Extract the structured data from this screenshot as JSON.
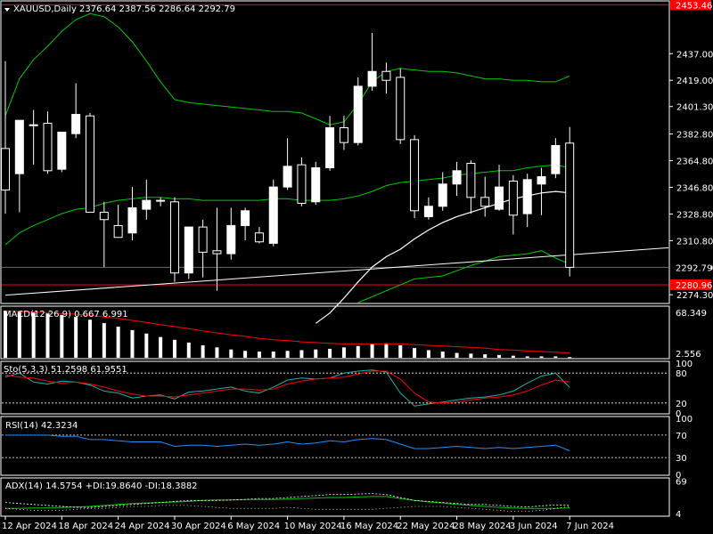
{
  "header": {
    "symbol": "XAUUSD,Daily",
    "ohlc": "2376.64 2387.56 2286.64 2292.79"
  },
  "colors": {
    "background": "#000000",
    "foreground": "#ffffff",
    "bull": "#ffffff",
    "bear": "#000000",
    "candle_outline": "#ffffff",
    "indicator_green": "#00c800",
    "moving_average": "#ffffff",
    "hline": "#ff0000",
    "macd_signal": "#ff0000",
    "stoch_main": "#20b2aa",
    "stoch_signal": "#ff0000",
    "rsi": "#1e90ff",
    "adx_dash": "#ffffff",
    "current_price_line": "#6b6b6b"
  },
  "chart_data": {
    "type": "candlestick",
    "symbol": "XAUUSD",
    "timeframe": "Daily",
    "price_axis_ticks": [
      "2437.00",
      "2419.00",
      "2401.30",
      "2382.80",
      "2364.80",
      "2346.80",
      "2328.80",
      "2310.80",
      "2292.79",
      "2274.30"
    ],
    "price_ylim": [
      2269,
      2472
    ],
    "horizontal_lines": [
      {
        "price": 2470.0,
        "label": "2453.46"
      },
      {
        "price": 2281.0,
        "label": "2280.96"
      }
    ],
    "current_price": 2292.79,
    "date_labels": [
      "12 Apr 2024",
      "18 Apr 2024",
      "24 Apr 2024",
      "30 Apr 2024",
      "6 May 2024",
      "10 May 2024",
      "16 May 2024",
      "22 May 2024",
      "28 May 2024",
      "3 Jun 2024",
      "7 Jun 2024"
    ],
    "candles": [
      {
        "o": 2373,
        "h": 2432,
        "l": 2329,
        "c": 2345
      },
      {
        "o": 2356,
        "h": 2391,
        "l": 2330,
        "c": 2392
      },
      {
        "o": 2389,
        "h": 2399,
        "l": 2362,
        "c": 2389
      },
      {
        "o": 2390,
        "h": 2398,
        "l": 2356,
        "c": 2358
      },
      {
        "o": 2359,
        "h": 2384,
        "l": 2357,
        "c": 2384
      },
      {
        "o": 2383,
        "h": 2417,
        "l": 2380,
        "c": 2396
      },
      {
        "o": 2395,
        "h": 2397,
        "l": 2330,
        "c": 2330
      },
      {
        "o": 2330,
        "h": 2337,
        "l": 2293,
        "c": 2325
      },
      {
        "o": 2321,
        "h": 2335,
        "l": 2316,
        "c": 2313
      },
      {
        "o": 2316,
        "h": 2347,
        "l": 2311,
        "c": 2333
      },
      {
        "o": 2332,
        "h": 2352,
        "l": 2325,
        "c": 2338
      },
      {
        "o": 2338,
        "h": 2340,
        "l": 2334,
        "c": 2338
      },
      {
        "o": 2337,
        "h": 2340,
        "l": 2283,
        "c": 2289
      },
      {
        "o": 2289,
        "h": 2320,
        "l": 2285,
        "c": 2320
      },
      {
        "o": 2320,
        "h": 2325,
        "l": 2286,
        "c": 2303
      },
      {
        "o": 2304,
        "h": 2333,
        "l": 2277,
        "c": 2302
      },
      {
        "o": 2302,
        "h": 2333,
        "l": 2298,
        "c": 2321
      },
      {
        "o": 2321,
        "h": 2333,
        "l": 2311,
        "c": 2331
      },
      {
        "o": 2316,
        "h": 2320,
        "l": 2309,
        "c": 2310
      },
      {
        "o": 2309,
        "h": 2352,
        "l": 2307,
        "c": 2347
      },
      {
        "o": 2347,
        "h": 2380,
        "l": 2345,
        "c": 2361
      },
      {
        "o": 2362,
        "h": 2367,
        "l": 2334,
        "c": 2336
      },
      {
        "o": 2337,
        "h": 2364,
        "l": 2335,
        "c": 2360
      },
      {
        "o": 2360,
        "h": 2395,
        "l": 2358,
        "c": 2387
      },
      {
        "o": 2387,
        "h": 2395,
        "l": 2372,
        "c": 2377
      },
      {
        "o": 2377,
        "h": 2421,
        "l": 2375,
        "c": 2415
      },
      {
        "o": 2415,
        "h": 2451,
        "l": 2412,
        "c": 2425
      },
      {
        "o": 2425,
        "h": 2431,
        "l": 2410,
        "c": 2419
      },
      {
        "o": 2421,
        "h": 2427,
        "l": 2376,
        "c": 2379
      },
      {
        "o": 2379,
        "h": 2382,
        "l": 2326,
        "c": 2331
      },
      {
        "o": 2327,
        "h": 2340,
        "l": 2325,
        "c": 2334
      },
      {
        "o": 2334,
        "h": 2357,
        "l": 2331,
        "c": 2349
      },
      {
        "o": 2349,
        "h": 2364,
        "l": 2341,
        "c": 2358
      },
      {
        "o": 2363,
        "h": 2365,
        "l": 2329,
        "c": 2340
      },
      {
        "o": 2340,
        "h": 2354,
        "l": 2327,
        "c": 2334
      },
      {
        "o": 2332,
        "h": 2362,
        "l": 2331,
        "c": 2347
      },
      {
        "o": 2351,
        "h": 2355,
        "l": 2315,
        "c": 2328
      },
      {
        "o": 2329,
        "h": 2356,
        "l": 2320,
        "c": 2352
      },
      {
        "o": 2349,
        "h": 2360,
        "l": 2328,
        "c": 2354
      },
      {
        "o": 2356,
        "h": 2380,
        "l": 2353,
        "c": 2375
      },
      {
        "o": 2376.64,
        "h": 2387.56,
        "l": 2286.64,
        "c": 2292.79
      }
    ],
    "bollinger_upper": [
      2395,
      2420,
      2433,
      2442,
      2452,
      2460,
      2464,
      2462,
      2455,
      2445,
      2432,
      2418,
      2406,
      2404,
      2403,
      2402,
      2401,
      2400,
      2399,
      2398,
      2398,
      2397,
      2393,
      2389,
      2391,
      2403,
      2418,
      2425,
      2427,
      2426,
      2425,
      2425,
      2424,
      2422,
      2420,
      2420,
      2419,
      2419,
      2418,
      2418,
      2422
    ],
    "bollinger_middle": [
      2308,
      2316,
      2321,
      2325,
      2329,
      2332,
      2333,
      2336,
      2338,
      2339,
      2340,
      2340,
      2339,
      2339,
      2338,
      2338,
      2338,
      2338,
      2338,
      2339,
      2339,
      2338,
      2338,
      2338,
      2339,
      2341,
      2344,
      2348,
      2350,
      2351,
      2352,
      2353,
      2355,
      2356,
      2357,
      2358,
      2358,
      2360,
      2361,
      2362,
      2360
    ],
    "moving_average": [
      null,
      null,
      null,
      null,
      null,
      null,
      null,
      null,
      null,
      null,
      null,
      null,
      null,
      null,
      null,
      null,
      null,
      null,
      null,
      null,
      null,
      null,
      2255,
      2262,
      2272,
      2283,
      2293,
      2300,
      2305,
      2312,
      2318,
      2323,
      2327,
      2330,
      2333,
      2336,
      2339,
      2341,
      2343,
      2344,
      2343
    ],
    "bollinger_lower_points": [
      [
        25,
        2269
      ],
      [
        27,
        2277
      ],
      [
        29,
        2285
      ],
      [
        31,
        2287
      ],
      [
        33,
        2294
      ],
      [
        35,
        2300
      ],
      [
        37,
        2302
      ],
      [
        38,
        2304
      ],
      [
        39,
        2299
      ],
      [
        40,
        2295
      ]
    ],
    "trendline": {
      "from": [
        0,
        2274
      ],
      "to": [
        47,
        2306
      ]
    },
    "macd": {
      "label": "MACD(12,26,9) 0.667 6.991",
      "axis_top": "68.349",
      "axis_bottom": "2.556",
      "ylim": [
        0,
        72
      ],
      "histogram": [
        68,
        67,
        66,
        64,
        62,
        59,
        55,
        50,
        45,
        40,
        35,
        30,
        26,
        22,
        18,
        15,
        12,
        10,
        9,
        9,
        10,
        11,
        12,
        13,
        15,
        17,
        20,
        21,
        18,
        14,
        11,
        9,
        7,
        6,
        5,
        4,
        3,
        2,
        2,
        2,
        1
      ],
      "signal": [
        68,
        67,
        66,
        65,
        64,
        63,
        61,
        59,
        57,
        54,
        51,
        48,
        45,
        42,
        39,
        36,
        33,
        31,
        28,
        26,
        25,
        23,
        22,
        21,
        20,
        20,
        20,
        20,
        20,
        19,
        18,
        17,
        16,
        15,
        14,
        12,
        11,
        10,
        9,
        8,
        7
      ]
    },
    "stochastic": {
      "label": "Sto(5,3,3) 51.2598 61.9551",
      "levels": [
        80,
        20
      ],
      "ticks": [
        "100",
        "80",
        "20",
        "0"
      ],
      "ylim": [
        0,
        100
      ],
      "main": [
        72,
        80,
        62,
        58,
        64,
        62,
        56,
        44,
        40,
        30,
        34,
        36,
        28,
        42,
        44,
        48,
        52,
        44,
        40,
        52,
        66,
        70,
        68,
        70,
        80,
        84,
        86,
        82,
        40,
        14,
        18,
        22,
        26,
        30,
        32,
        36,
        44,
        60,
        74,
        80,
        51
      ],
      "signal": [
        76,
        72,
        70,
        64,
        60,
        62,
        58,
        52,
        44,
        38,
        34,
        34,
        32,
        36,
        40,
        44,
        48,
        48,
        46,
        48,
        58,
        64,
        68,
        70,
        72,
        78,
        84,
        84,
        68,
        40,
        22,
        20,
        22,
        26,
        30,
        32,
        36,
        44,
        56,
        66,
        62
      ]
    },
    "rsi": {
      "label": "RSI(14) 42.3234",
      "levels": [
        70,
        30
      ],
      "ticks": [
        "100",
        "70",
        "30",
        "0"
      ],
      "ylim": [
        0,
        100
      ],
      "values": [
        70,
        70,
        70,
        70,
        68,
        68,
        62,
        62,
        60,
        58,
        58,
        58,
        50,
        52,
        52,
        50,
        52,
        54,
        52,
        54,
        58,
        54,
        56,
        60,
        58,
        62,
        64,
        62,
        54,
        46,
        46,
        48,
        50,
        48,
        46,
        48,
        46,
        48,
        50,
        52,
        42
      ]
    },
    "adx": {
      "label": "ADX(14) 14.5754 +DI:19.8640 -DI:18.3882",
      "ticks": [
        "69",
        "4"
      ],
      "ylim": [
        0,
        72
      ],
      "adx": [
        14,
        14,
        15,
        15,
        16,
        17,
        18,
        20,
        22,
        24,
        25,
        26,
        27,
        28,
        30,
        31,
        31,
        32,
        32,
        32,
        33,
        34,
        35,
        36,
        36,
        37,
        38,
        38,
        34,
        30,
        27,
        25,
        22,
        20,
        18,
        16,
        15,
        14,
        14,
        14,
        15
      ],
      "plus_di": [
        26,
        24,
        22,
        20,
        18,
        16,
        16,
        18,
        20,
        22,
        24,
        26,
        28,
        30,
        30,
        30,
        31,
        32,
        34,
        34,
        36,
        38,
        40,
        42,
        42,
        43,
        44,
        42,
        36,
        30,
        28,
        26,
        24,
        22,
        22,
        20,
        18,
        17,
        19,
        21,
        20
      ],
      "minus_di": [
        14,
        12,
        10,
        10,
        10,
        12,
        14,
        14,
        16,
        18,
        18,
        20,
        20,
        20,
        18,
        16,
        14,
        14,
        14,
        14,
        16,
        14,
        12,
        12,
        12,
        12,
        12,
        14,
        16,
        18,
        18,
        18,
        16,
        14,
        12,
        10,
        8,
        8,
        10,
        14,
        18
      ]
    }
  }
}
